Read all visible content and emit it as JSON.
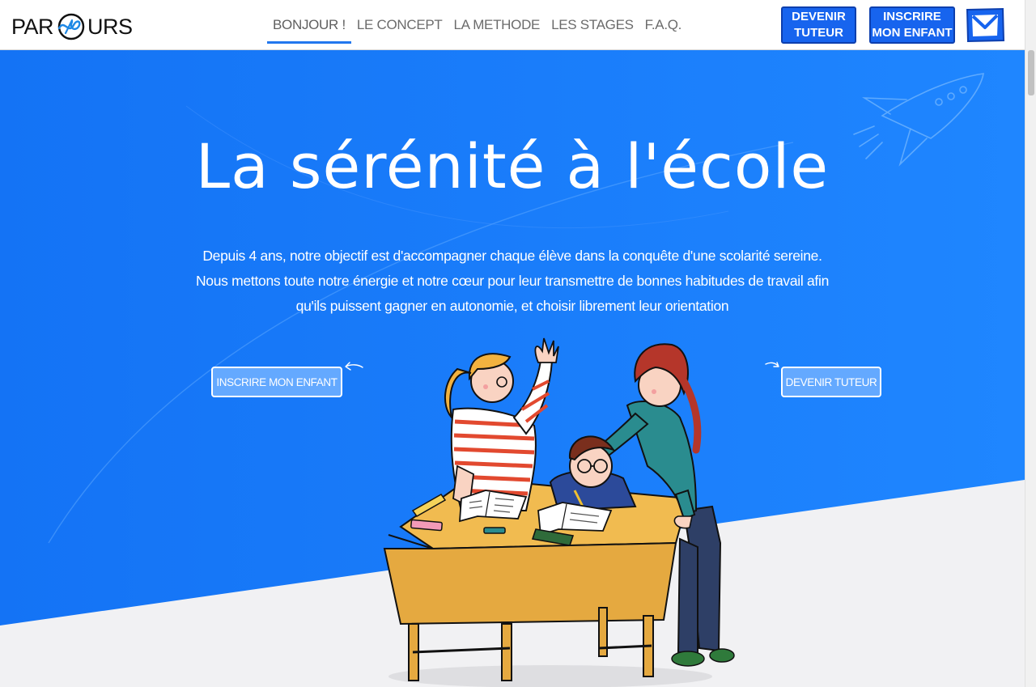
{
  "logo": {
    "left": "PAR",
    "right": "URS"
  },
  "nav": {
    "items": [
      {
        "label": "BONJOUR !",
        "active": true
      },
      {
        "label": "LE CONCEPT",
        "active": false
      },
      {
        "label": "LA METHODE",
        "active": false
      },
      {
        "label": "LES STAGES",
        "active": false
      },
      {
        "label": "F.A.Q.",
        "active": false
      }
    ]
  },
  "header_buttons": {
    "tutor": "DEVENIR\nTUTEUR",
    "enfant": "INSCRIRE\nMON ENFANT",
    "mail_icon": "mail-icon"
  },
  "hero": {
    "title": "La sérénité à l'école",
    "text": "Depuis 4 ans, notre objectif est d'accompagner chaque élève dans la conquête d'une scolarité sereine. Nous mettons toute notre énergie et notre cœur pour leur transmettre de bonnes habitudes de travail afin qu'ils puissent gagner en autonomie, et choisir librement leur orientation",
    "cta_left": "INSCRIRE MON ENFANT",
    "cta_right": "DEVENIR TUTEUR"
  },
  "colors": {
    "hero_blue": "#1a7cfb",
    "header_button": "#1764ee",
    "nav_underline": "#2277ee",
    "page_bg": "#f1f1f3"
  }
}
